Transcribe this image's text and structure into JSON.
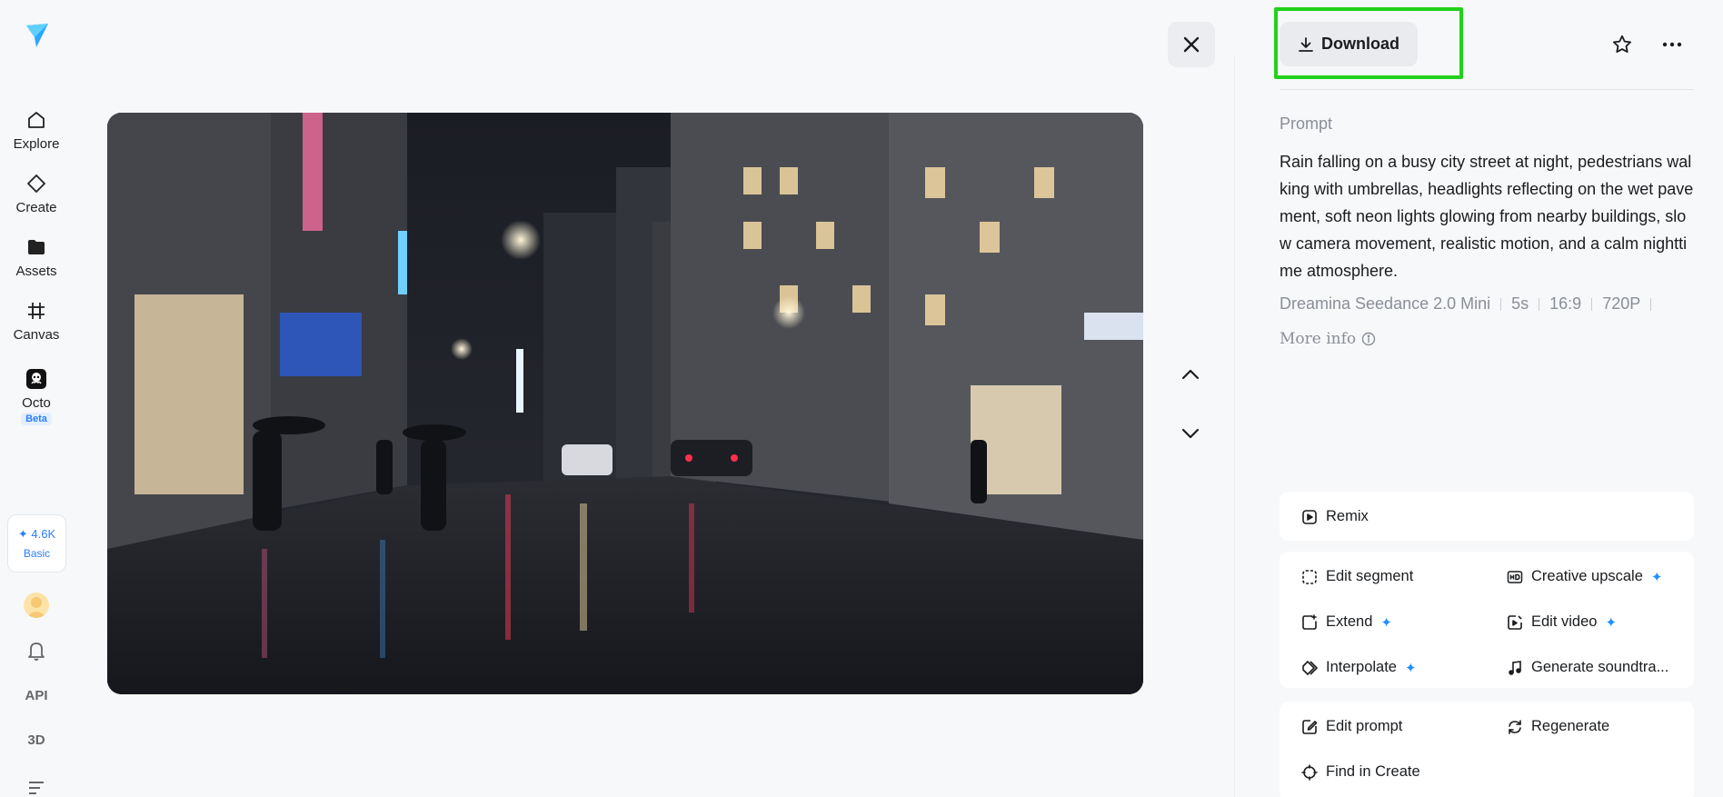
{
  "nav": {
    "items": [
      {
        "label": "Explore",
        "icon": "home-icon"
      },
      {
        "label": "Create",
        "icon": "diamond-icon"
      },
      {
        "label": "Assets",
        "icon": "folder-icon"
      },
      {
        "label": "Canvas",
        "icon": "canvas-icon"
      },
      {
        "label": "Octo",
        "icon": "octo-icon",
        "badge": "Beta"
      }
    ],
    "credits": {
      "amount": "✦ 4.6K",
      "tier": "Basic"
    },
    "api_label": "API",
    "threed_label": "3D"
  },
  "toolbar": {
    "download_label": "Download"
  },
  "prompt": {
    "label": "Prompt",
    "text": "Rain falling on a busy city street at night, pedestrians walking with umbrellas, headlights reflecting on the wet pavement, soft neon lights glowing from nearby buildings, slow camera movement, realistic motion, and a calm nighttime atmosphere.",
    "model": "Dreamina Seedance 2.0 Mini",
    "duration": "5s",
    "ratio": "16:9",
    "resolution": "720P",
    "more_info": "More info"
  },
  "actions": {
    "remix": "Remix",
    "edit_segment": "Edit segment",
    "creative_upscale": "Creative upscale",
    "extend": "Extend",
    "edit_video": "Edit video",
    "interpolate": "Interpolate",
    "generate_soundtrack": "Generate soundtra...",
    "edit_prompt": "Edit prompt",
    "regenerate": "Regenerate",
    "find_in_create": "Find in Create"
  },
  "colors": {
    "accent": "#1e90ff",
    "highlight": "#22d11b"
  }
}
